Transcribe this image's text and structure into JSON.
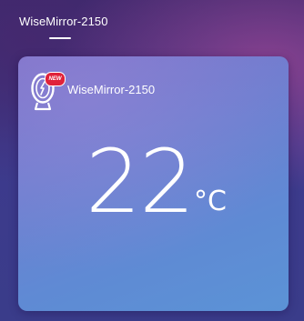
{
  "header": {
    "title": "WiseMirror-2150"
  },
  "device_card": {
    "icon": "mirror-device-icon",
    "badge": "NEW",
    "name": "WiseMirror-2150",
    "temperature": "22",
    "unit": "°C"
  },
  "colors": {
    "badge": "#e0223a",
    "text": "#ffffff"
  }
}
